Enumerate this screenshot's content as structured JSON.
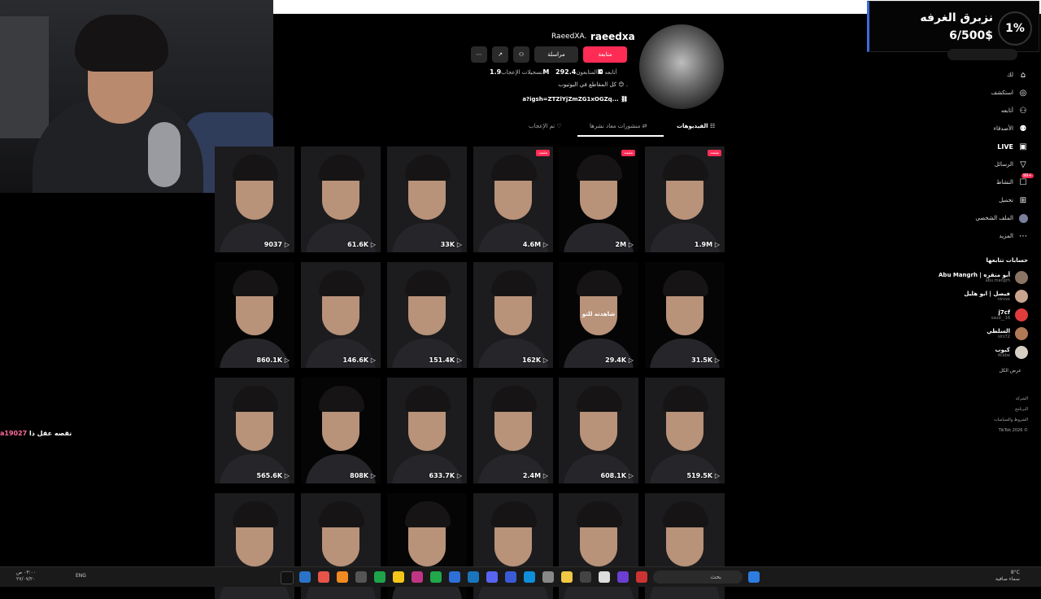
{
  "overlay": {
    "goal_title": "نزبرق الغرفه",
    "goal_value": "6/500$",
    "goal_percent": "1%",
    "chat_user": "a19027",
    "chat_text": "نقصه عقل ذا"
  },
  "profile": {
    "username": "raeedxa",
    "display_name": "RaeedXA.",
    "follow_label": "متابعة",
    "message_label": "مراسلة",
    "following_label": "أتابعه",
    "following_count": "0",
    "followers_label": "المتابعون",
    "followers_count": "292.4K",
    "likes_label": "تسجيلات الإعجاب",
    "likes_count": "1.9M",
    "bio": "كل المقاطع في اليوتيوب 😊 .",
    "link": "a?igsh=ZTZlYjZmZG1xOGZq...",
    "tabs": [
      "الفيديوهات",
      "منشورات معاد نشرها",
      "تم الإعجاب"
    ]
  },
  "sidebar": {
    "items": [
      {
        "label": "لك",
        "icon": "home-icon"
      },
      {
        "label": "استكشف",
        "icon": "compass-icon"
      },
      {
        "label": "أتابعه",
        "icon": "following-icon"
      },
      {
        "label": "الأصدقاء",
        "icon": "friends-icon"
      },
      {
        "label": "LIVE",
        "icon": "live-icon"
      },
      {
        "label": "الرسائل",
        "icon": "messages-icon"
      },
      {
        "label": "النشاط",
        "icon": "activity-icon",
        "badge": "99+"
      },
      {
        "label": "تحميل",
        "icon": "upload-icon"
      },
      {
        "label": "الملف الشخصي",
        "icon": "profile-icon"
      },
      {
        "label": "المزيد",
        "icon": "more-icon"
      }
    ],
    "following_header": "حسابات تتابعها",
    "following": [
      {
        "name": "Abu Mangrh | أبو منقره",
        "handle": "abu.mangrh"
      },
      {
        "name": "فيصل | ابو هليل",
        "handle": "nirvvx"
      },
      {
        "name": "j7cf",
        "handle": "saud__16"
      },
      {
        "name": "السلطي",
        "handle": "slrz72"
      },
      {
        "name": "كيوب",
        "handle": "4cebe"
      }
    ],
    "see_all": "عرض الكل",
    "footer": [
      "الشركة",
      "البرنامج",
      "الشروط والسياسات",
      "TikTok 2026 ©"
    ]
  },
  "videos": [
    {
      "views": "1.9M",
      "pinned": "مثبت"
    },
    {
      "views": "2M",
      "pinned": "مثبت"
    },
    {
      "views": "4.6M",
      "pinned": "مثبت"
    },
    {
      "views": "33K"
    },
    {
      "views": "61.6K"
    },
    {
      "views": "9037"
    },
    {
      "views": "31.5K"
    },
    {
      "views": "29.4K",
      "overlay": "شاهدته للتو"
    },
    {
      "views": "162K"
    },
    {
      "views": "151.4K"
    },
    {
      "views": "146.6K"
    },
    {
      "views": "860.1K"
    },
    {
      "views": "519.5K"
    },
    {
      "views": "608.1K"
    },
    {
      "views": "2.4M"
    },
    {
      "views": "633.7K"
    },
    {
      "views": "808K"
    },
    {
      "views": "565.6K"
    },
    {
      "views": ""
    },
    {
      "views": ""
    },
    {
      "views": ""
    },
    {
      "views": ""
    },
    {
      "views": ""
    },
    {
      "views": ""
    }
  ],
  "taskbar": {
    "search_placeholder": "بحث",
    "lang": "ENG",
    "time": "٠٣:٠٠ ص",
    "date": "٢٧/٠٧/٢٠",
    "weather_temp": "8°C",
    "weather_text": "سماء صافية"
  },
  "colors": {
    "accent": "#fe2c55",
    "bg": "#000000"
  }
}
